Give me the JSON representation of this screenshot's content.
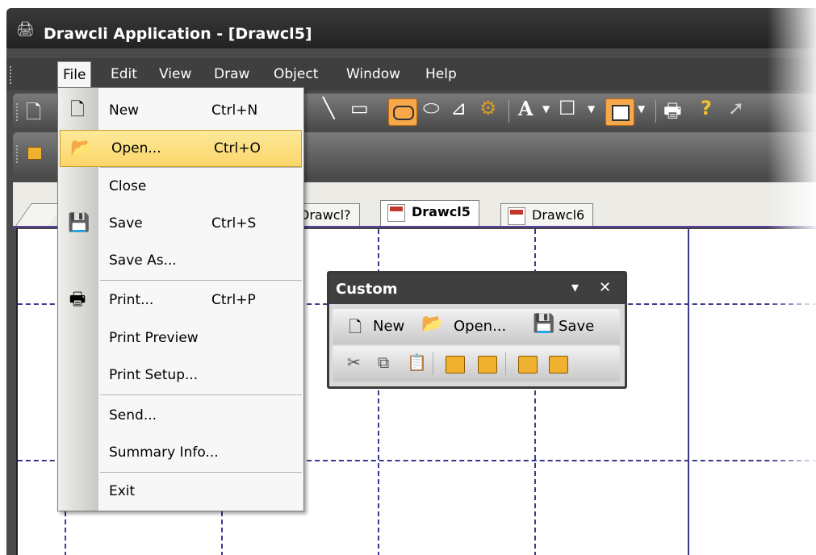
{
  "window": {
    "title": "Drawcli Application - [Drawcl5]"
  },
  "menubar": {
    "items": [
      {
        "label": "File"
      },
      {
        "label": "Edit"
      },
      {
        "label": "View"
      },
      {
        "label": "Draw"
      },
      {
        "label": "Object"
      },
      {
        "label": "Window"
      },
      {
        "label": "Help"
      }
    ]
  },
  "toolbar": {
    "text_tool": "A",
    "help_glyph": "?"
  },
  "tabs": [
    {
      "label": "Drawcl?"
    },
    {
      "label": "Drawcl5"
    },
    {
      "label": "Drawcl6"
    }
  ],
  "file_menu": {
    "items": [
      {
        "label": "New",
        "shortcut": "Ctrl+N",
        "icon": "new-file-icon"
      },
      {
        "label": "Open...",
        "shortcut": "Ctrl+O",
        "icon": "open-folder-icon"
      },
      {
        "label": "Close",
        "shortcut": ""
      },
      {
        "label": "Save",
        "shortcut": "Ctrl+S",
        "icon": "save-disk-icon"
      },
      {
        "label": "Save As...",
        "shortcut": ""
      },
      {
        "label": "Print...",
        "shortcut": "Ctrl+P",
        "icon": "printer-icon"
      },
      {
        "label": "Print Preview",
        "shortcut": ""
      },
      {
        "label": "Print Setup...",
        "shortcut": ""
      },
      {
        "label": "Send...",
        "shortcut": ""
      },
      {
        "label": "Summary Info...",
        "shortcut": ""
      },
      {
        "label": "Exit",
        "shortcut": ""
      }
    ]
  },
  "custom_toolbar": {
    "title": "Custom",
    "dropdown_glyph": "▾",
    "close_glyph": "✕",
    "new_label": "New",
    "open_label": "Open...",
    "save_label": "Save"
  },
  "colors": {
    "highlight": "#fbd569",
    "active_shape_tool": "#f7a84a"
  }
}
